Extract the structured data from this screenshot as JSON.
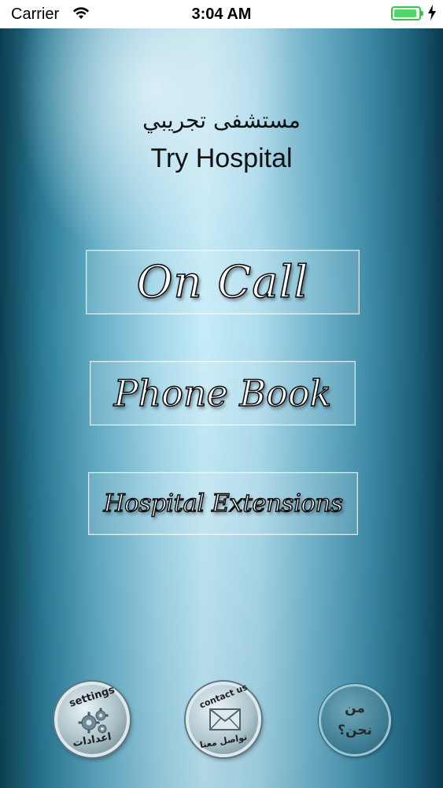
{
  "status_bar": {
    "carrier": "Carrier",
    "time": "3:04 AM",
    "wifi_icon": "wifi-icon",
    "battery_icon": "battery-icon",
    "charging_icon": "lightning-bolt-icon",
    "battery_color": "#4cd964"
  },
  "header": {
    "title_ar": "مستشفى تجريبي",
    "title_en": "Try Hospital"
  },
  "menu": {
    "on_call": "On Call",
    "phone_book": "Phone Book",
    "hospital_extensions": "Hospital Extensions"
  },
  "bottom_bar": {
    "settings": {
      "label_en": "settings",
      "label_ar": "اعدادات",
      "icon": "gears-icon"
    },
    "contact": {
      "label_en": "contact us",
      "label_ar": "تواصل معنا",
      "icon": "envelope-icon"
    },
    "about": {
      "label_line1": "من",
      "label_line2": "نحن؟"
    }
  },
  "colors": {
    "background_dark": "#0e3f52",
    "background_light": "#c6ecf8",
    "text": "#111111"
  }
}
